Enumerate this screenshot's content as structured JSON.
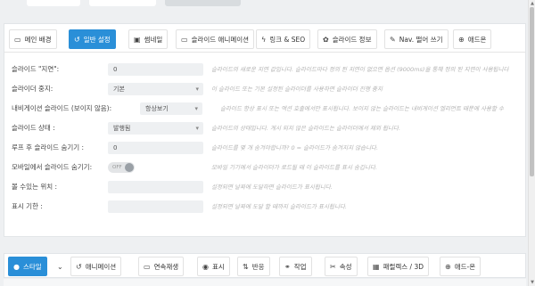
{
  "top_tabs": [
    {
      "id": "main-bg",
      "label": "메인 배경",
      "icon": "image-icon",
      "glyph": "▭",
      "active": false
    },
    {
      "id": "general",
      "label": "일반 설정",
      "icon": "history-icon",
      "glyph": "↺",
      "active": true
    },
    {
      "id": "thumbnail",
      "label": "썸네일",
      "icon": "thumbnail-icon",
      "glyph": "▣",
      "active": false
    },
    {
      "id": "slider-animation",
      "label": "슬라이드 애니메이션",
      "icon": "battery-icon",
      "glyph": "▭",
      "active": false
    },
    {
      "id": "link-seo",
      "label": "링크 & SEO",
      "icon": "bolt-icon",
      "glyph": "ϟ",
      "active": false
    },
    {
      "id": "slider-info",
      "label": "슬라이드 정보",
      "icon": "gear-icon",
      "glyph": "✿",
      "active": false
    },
    {
      "id": "nav-skip",
      "label": "Nav. 떨어 쓰기",
      "icon": "wand-icon",
      "glyph": "✎",
      "active": false
    },
    {
      "id": "addon",
      "label": "애드온",
      "icon": "plus-circle-icon",
      "glyph": "⊕",
      "active": false
    }
  ],
  "settings": [
    {
      "label": "슬라이드 \"지연\":",
      "type": "input",
      "value": "0",
      "desc": "슬라이드의 새로운 지연 값입니다. 슬라이드마다 정의 된 지연이 없으면 옵션 (9000ms)을 통해 정의 된 지연이 사용됩니다"
    },
    {
      "label": "슬라이더 중지:",
      "type": "select",
      "value": "기본",
      "desc": "이 슬라이드 또는 기본 설정된 슬라이더를 사용하면 슬라이더 진행 중지"
    },
    {
      "label": "내비게이션 슬라이드 (보이지 않음):",
      "type": "select-narrow",
      "value": "항상보기",
      "desc": "슬라이드 항상 표시 또는 액션 호출에서만 표시됩니다. 보이지 않는 슬라이드는 내비게이션 엘리먼트 때문에 사용할 수"
    },
    {
      "label": "슬라이드 상태 :",
      "type": "select",
      "value": "발행됨",
      "desc": "슬라이드의 상태입니다. 게시 되지 않은 슬라이드는 슬라이더에서 제외 됩니다."
    },
    {
      "label": "루프 후 슬라이드 숨기기 :",
      "type": "input",
      "value": "0",
      "desc": "슬라이드를 몇 개 숨겨야합니까? 0 = 슬라이드가 숨겨지지 않습니다."
    },
    {
      "label": "모바일에서 슬라이드 숨기기:",
      "type": "toggle",
      "value": "OFF",
      "desc": "모바일 기기에서 슬라이더가 로드될 때 이 슬라이드를 표시 숨깁니다."
    },
    {
      "label": "볼 수있는 위치 :",
      "type": "input",
      "value": "",
      "desc": "설정되면 날짜에 도달하면 슬라이드가 표시됩니다."
    },
    {
      "label": "표시 기한 :",
      "type": "input",
      "value": "",
      "desc": "설정되면 날짜에 도달 할 때까지 슬라이드가 표시됩니다."
    }
  ],
  "bottom_tabs": [
    {
      "id": "style",
      "label": "스타일",
      "icon": "droplet-icon",
      "glyph": "●",
      "active": true
    },
    {
      "id": "more",
      "label": "",
      "icon": "chevron-down-icon",
      "glyph": "⌄",
      "active": false
    },
    {
      "id": "animation",
      "label": "애니메이션",
      "icon": "history-icon",
      "glyph": "↺",
      "active": false
    },
    {
      "id": "loop",
      "label": "연속재생",
      "icon": "battery-icon",
      "glyph": "▭",
      "active": false
    },
    {
      "id": "visibility",
      "label": "표시",
      "icon": "eye-icon",
      "glyph": "◉",
      "active": false
    },
    {
      "id": "actions",
      "label": "반응",
      "icon": "arrows-icon",
      "glyph": "⇅",
      "active": false
    },
    {
      "id": "action",
      "label": "작업",
      "icon": "link-icon",
      "glyph": "⚭",
      "active": false
    },
    {
      "id": "attributes",
      "label": "속성",
      "icon": "tools-icon",
      "glyph": "✂",
      "active": false
    },
    {
      "id": "parallax",
      "label": "패럴렉스 / 3D",
      "icon": "image-icon",
      "glyph": "▦",
      "active": false
    },
    {
      "id": "addons",
      "label": "애드-온",
      "icon": "plus-circle-icon",
      "glyph": "⊕",
      "active": false
    }
  ],
  "colors": {
    "accent": "#2a8fd8"
  }
}
